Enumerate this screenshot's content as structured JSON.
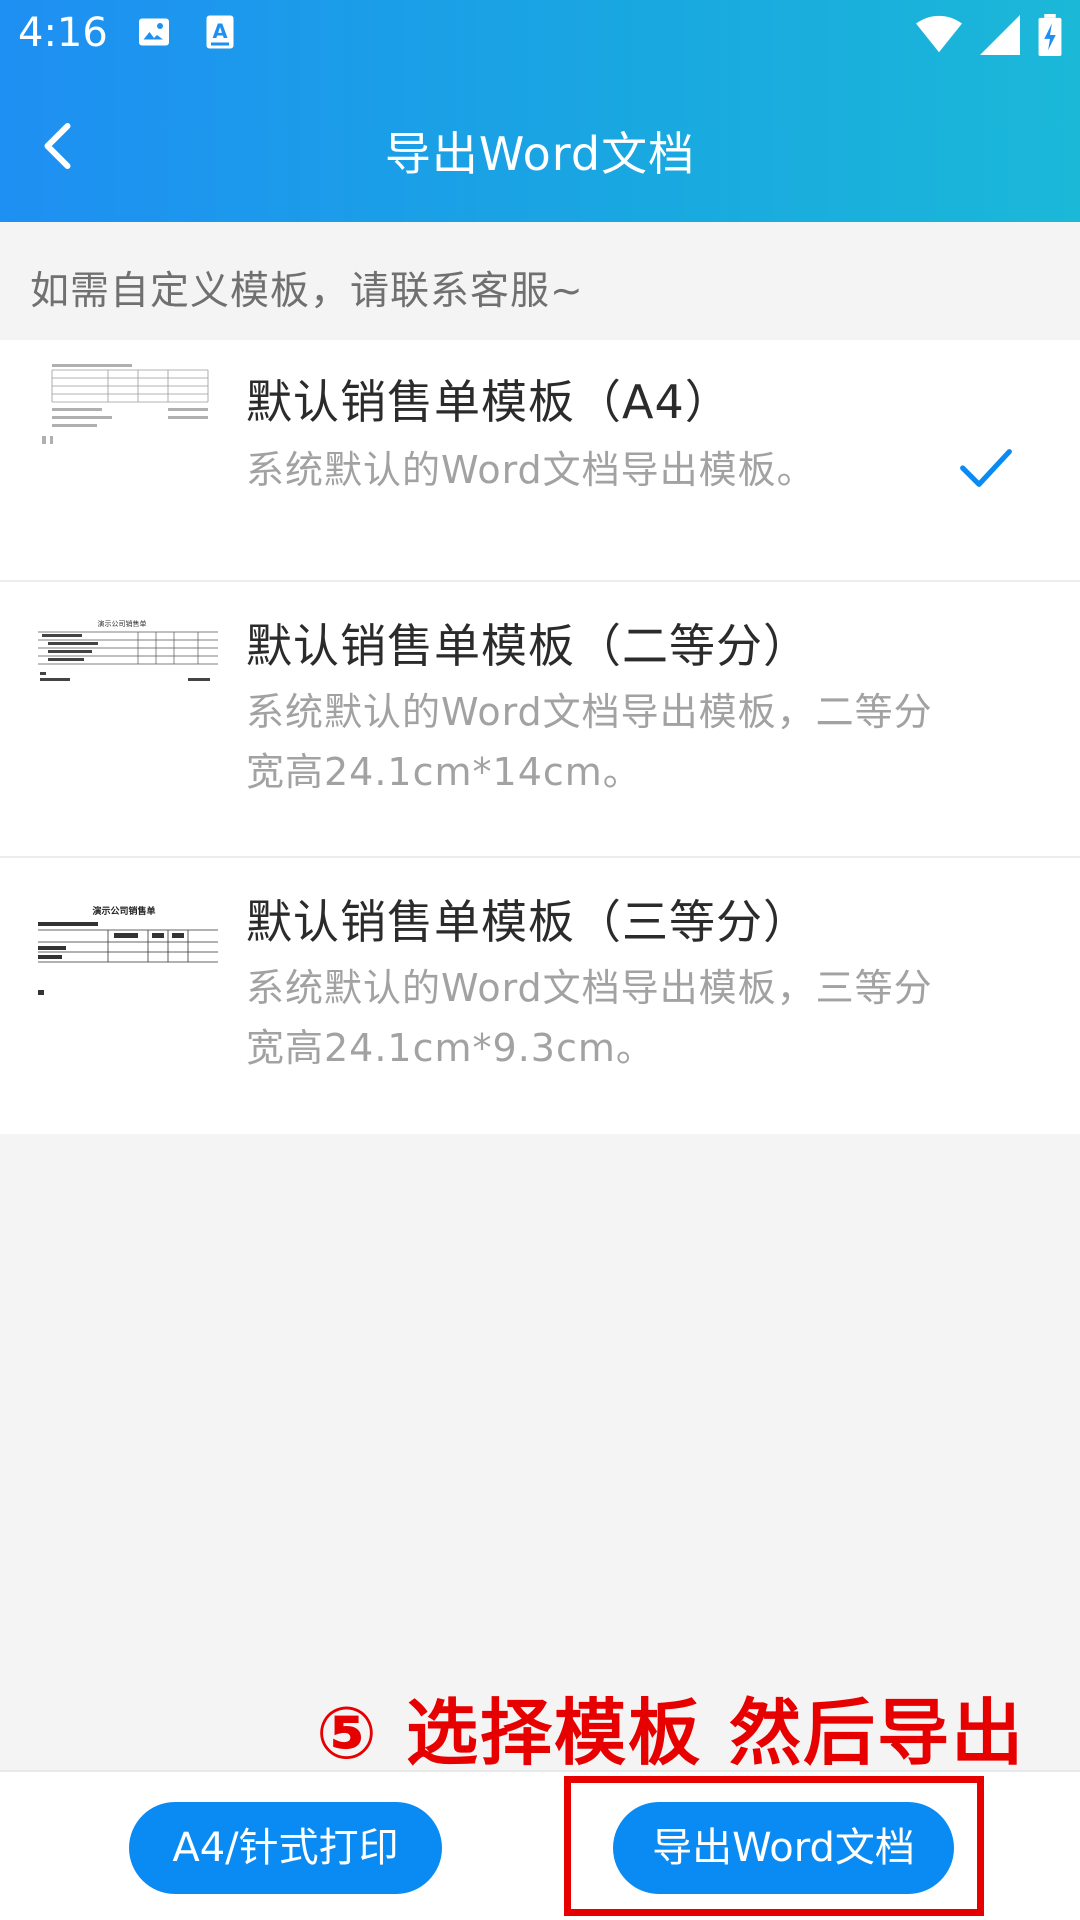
{
  "status_bar": {
    "time": "4:16",
    "icons": [
      "image-icon",
      "font-download-icon",
      "wifi-icon",
      "signal-icon",
      "battery-charging-icon"
    ]
  },
  "header": {
    "title": "导出Word文档",
    "back_icon": "chevron-left-icon"
  },
  "hint": "如需自定义模板，请联系客服~",
  "templates": [
    {
      "title": "默认销售单模板（A4）",
      "description": "系统默认的Word文档导出模板。",
      "selected": true,
      "thumbnail_title": ""
    },
    {
      "title": "默认销售单模板（二等分）",
      "description": "系统默认的Word文档导出模板，二等分宽高24.1cm*14cm。",
      "selected": false,
      "thumbnail_title": "演示公司销售单"
    },
    {
      "title": "默认销售单模板（三等分）",
      "description": "系统默认的Word文档导出模板，三等分宽高24.1cm*9.3cm。",
      "selected": false,
      "thumbnail_title": "演示公司销售单"
    }
  ],
  "annotation": "⑤ 选择模板 然后导出",
  "bottom_bar": {
    "print_label": "A4/针式打印",
    "export_label": "导出Word文档"
  },
  "colors": {
    "header_gradient_start": "#1e8ff3",
    "header_gradient_end": "#1bb8d8",
    "accent": "#0a8bf4",
    "annotation": "#e60000"
  }
}
